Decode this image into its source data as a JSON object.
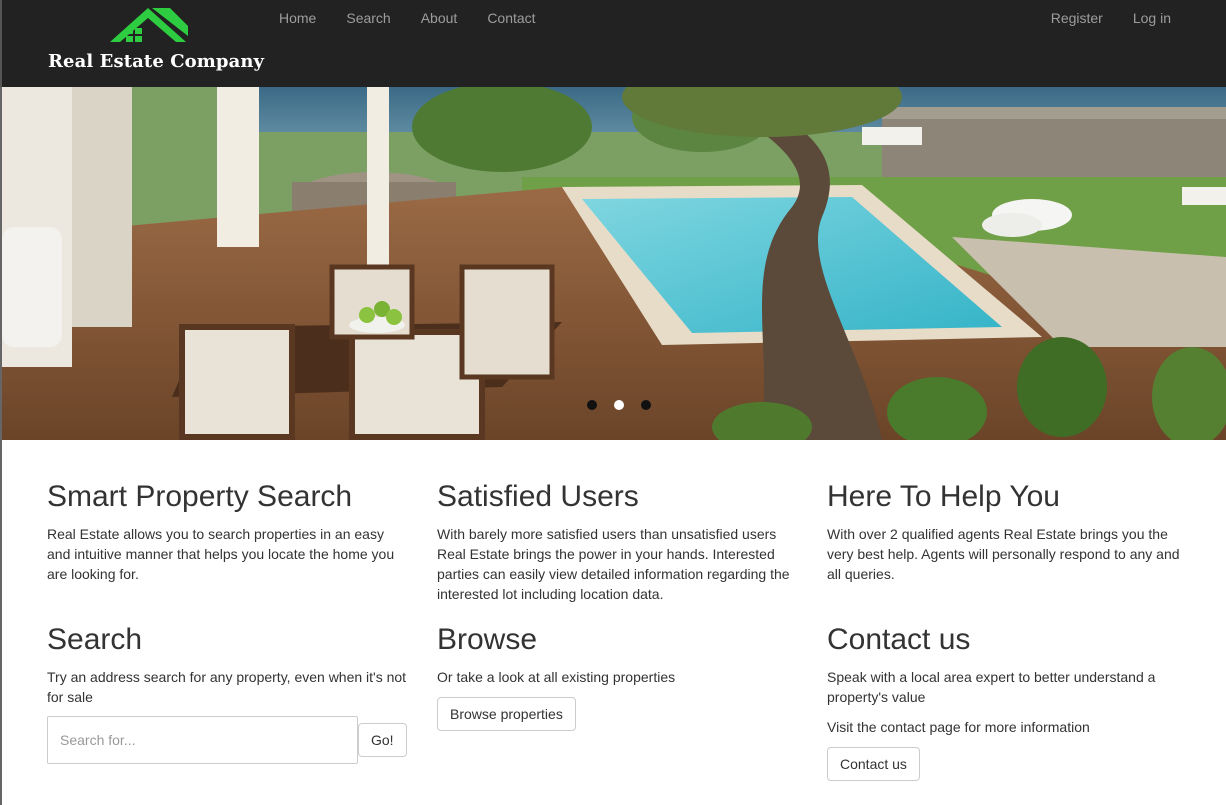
{
  "brand": {
    "name": "Real Estate Company",
    "logo_icon": "house-icon",
    "accent_color": "#2ecc40"
  },
  "nav": {
    "left": [
      "Home",
      "Search",
      "About",
      "Contact"
    ],
    "right": [
      "Register",
      "Log in"
    ]
  },
  "carousel": {
    "slide_count": 3,
    "active_index": 1
  },
  "features": [
    {
      "title": "Smart Property Search",
      "text": "Real Estate allows you to search properties in an easy and intuitive manner that helps you locate the home you are looking for."
    },
    {
      "title": "Satisfied Users",
      "text": "With barely more satisfied users than unsatisfied users Real Estate brings the power in your hands. Interested parties can easily view detailed information regarding the interested lot including location data."
    },
    {
      "title": "Here To Help You",
      "text": "With over 2 qualified agents Real Estate brings you the very best help. Agents will personally respond to any and all queries."
    }
  ],
  "search": {
    "title": "Search",
    "text": "Try an address search for any property, even when it's not for sale",
    "placeholder": "Search for...",
    "button": "Go!"
  },
  "browse": {
    "title": "Browse",
    "text": "Or take a look at all existing properties",
    "button": "Browse properties"
  },
  "contact": {
    "title": "Contact us",
    "text": "Speak with a local area expert to better understand a property's value",
    "text2": "Visit the contact page for more information",
    "button": "Contact us"
  }
}
